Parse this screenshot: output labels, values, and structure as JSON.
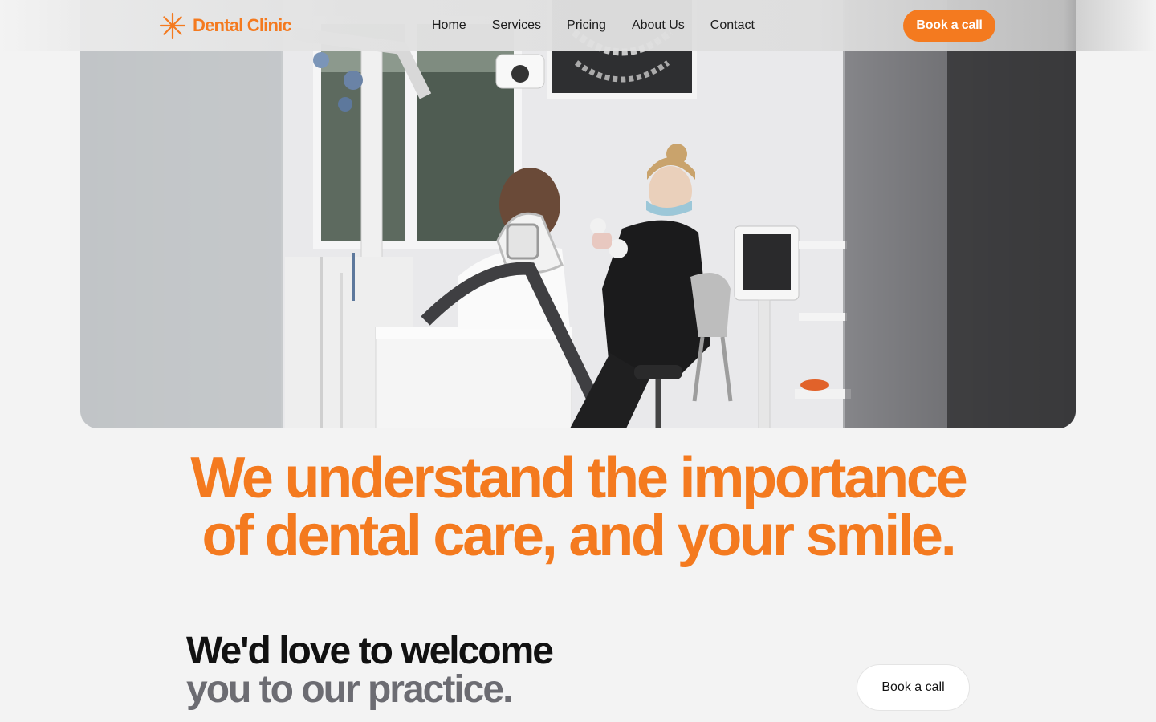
{
  "brand": {
    "name": "Dental Clinic",
    "icon": "sparkle-asterisk-icon",
    "color": "#f47a1f"
  },
  "nav": {
    "links": [
      "Home",
      "Services",
      "Pricing",
      "About Us",
      "Contact"
    ],
    "cta": "Book a call"
  },
  "hero": {
    "image": "dentist-treating-patient-photo"
  },
  "headline": {
    "line1": "We understand the importance",
    "line2": "of dental care, and your smile."
  },
  "welcome": {
    "line1": "We'd love to welcome",
    "line2": "you to our practice.",
    "cta": "Book a call"
  },
  "colors": {
    "accent": "#f47a1f",
    "background": "#f3f3f3",
    "muted_text": "#6c6c72"
  }
}
